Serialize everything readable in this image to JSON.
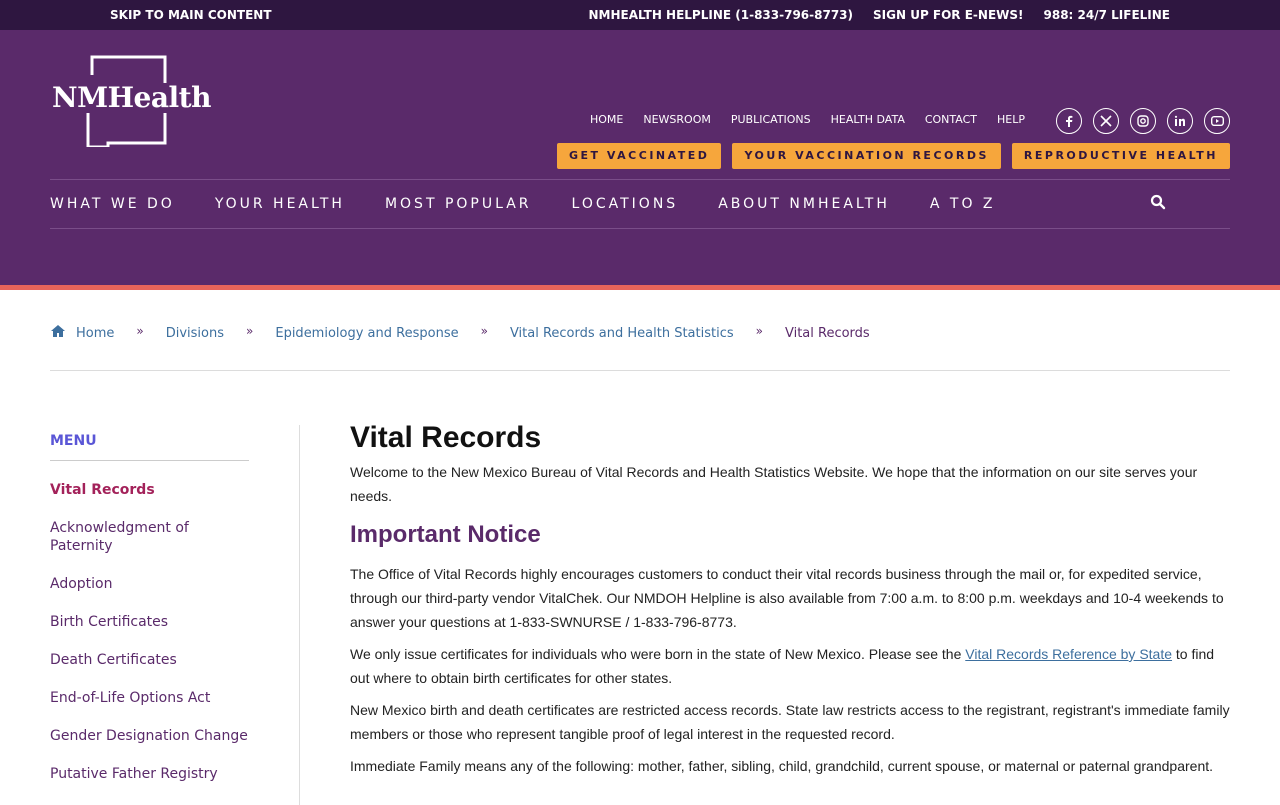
{
  "utility": {
    "skip": "SKIP TO MAIN CONTENT",
    "helpline": "NMHEALTH HELPLINE (1-833-796-8773)",
    "signup": "SIGN UP FOR E-NEWS!",
    "lifeline": "988: 24/7 LIFELINE"
  },
  "logo": {
    "text": "NMHealth"
  },
  "secondary_nav": [
    "HOME",
    "NEWSROOM",
    "PUBLICATIONS",
    "HEALTH DATA",
    "CONTACT",
    "HELP"
  ],
  "social": [
    "facebook-icon",
    "x-icon",
    "instagram-icon",
    "linkedin-icon",
    "youtube-icon"
  ],
  "cta": [
    "GET VACCINATED",
    "YOUR VACCINATION RECORDS",
    "REPRODUCTIVE HEALTH"
  ],
  "main_nav": [
    "WHAT WE DO",
    "YOUR HEALTH",
    "MOST POPULAR",
    "LOCATIONS",
    "ABOUT NMHEALTH",
    "A TO Z"
  ],
  "breadcrumb": [
    "Home",
    "Divisions",
    "Epidemiology and Response",
    "Vital Records and Health Statistics",
    "Vital Records"
  ],
  "sidebar": {
    "title": "MENU",
    "items": [
      "Vital Records",
      "Acknowledgment of Paternity",
      "Adoption",
      "Birth Certificates",
      "Death Certificates",
      "End-of-Life Options Act",
      "Gender Designation Change",
      "Putative Father Registry"
    ]
  },
  "content": {
    "title": "Vital Records",
    "intro": "Welcome to the New Mexico Bureau of Vital Records and Health Statistics Website. We hope that the information on our site serves your needs.",
    "notice_heading": "Important Notice",
    "p1": "The Office of Vital Records highly encourages customers to conduct their vital records business through the mail or, for expedited service, through our third-party vendor VitalChek. Our NMDOH Helpline is also available from 7:00 a.m. to 8:00 p.m. weekdays and 10-4 weekends to answer your questions at 1-833-SWNURSE / 1-833-796-8773.",
    "p2_before": "We only issue certificates for individuals who were born in the state of New Mexico. Please see the ",
    "p2_link": "Vital Records Reference by State",
    "p2_after": " to find out where to obtain birth certificates for other states.",
    "p3": "New Mexico birth and death certificates are restricted access records. State law restricts access to the registrant, registrant's immediate family members or those who represent tangible proof of legal interest in the requested record.",
    "p4": "Immediate Family means any of the following: mother, father, sibling, child, grandchild, current spouse, or maternal or paternal grandparent."
  },
  "colors": {
    "header_bg": "#5a2a6a",
    "utility_bg": "#2e1640",
    "accent": "#e8645a",
    "cta": "#f6a63c"
  }
}
